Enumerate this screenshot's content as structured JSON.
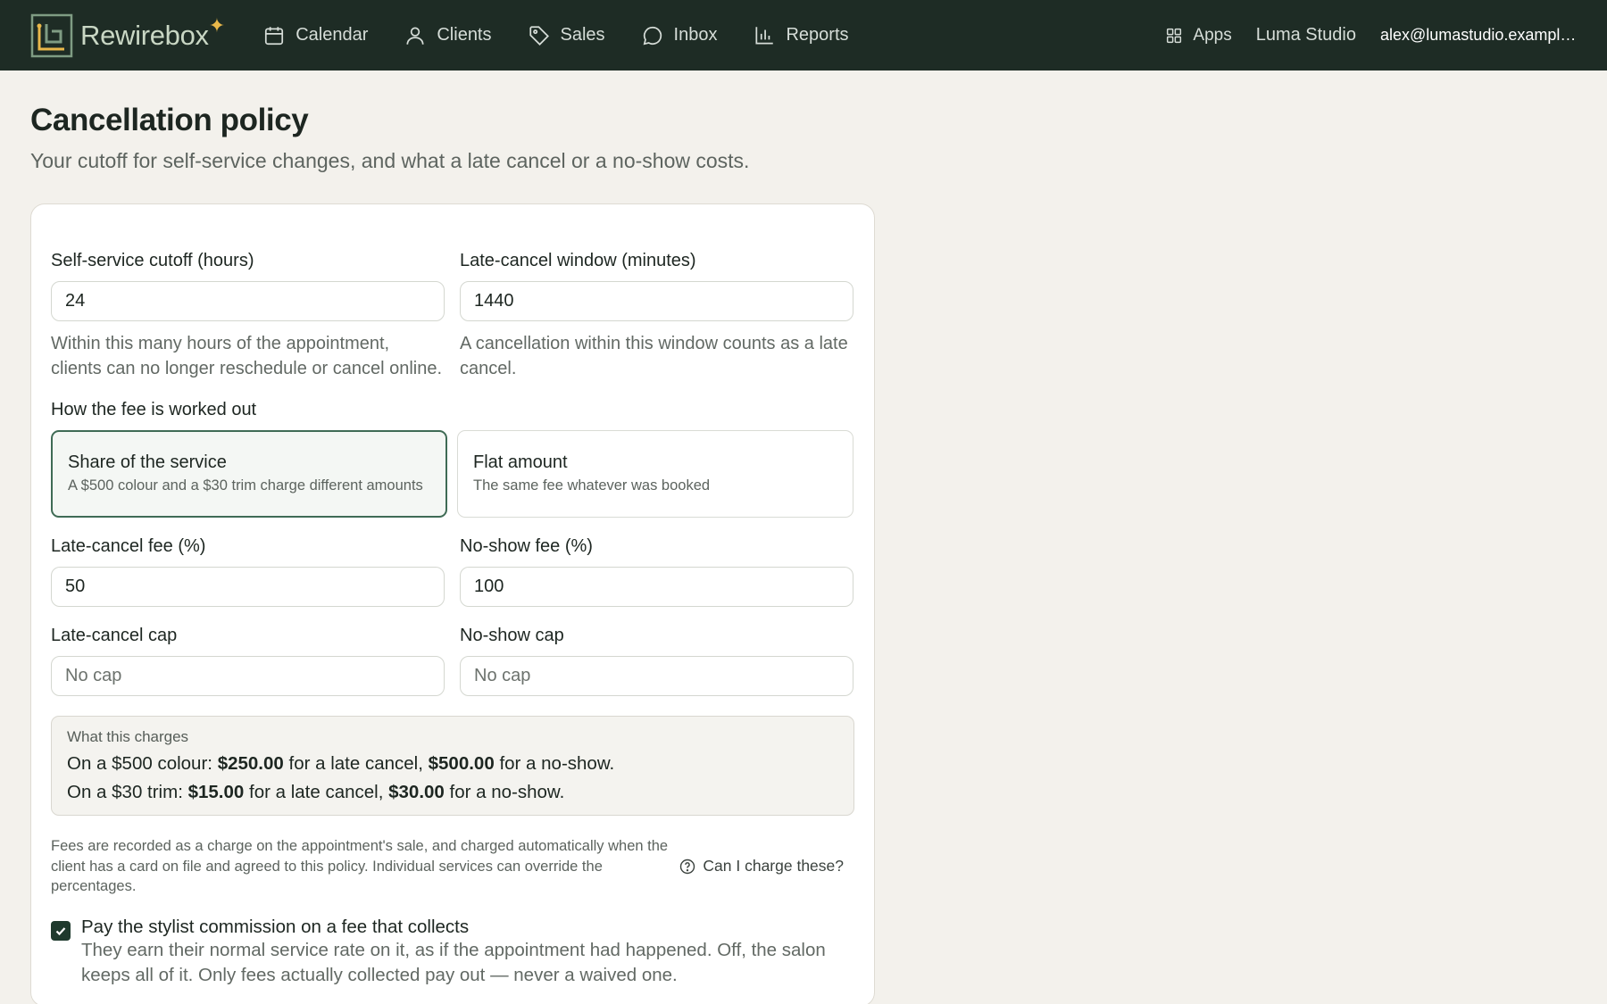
{
  "nav": {
    "brand": "Rewirebox",
    "brand_spark": "✦",
    "items": [
      {
        "label": "Calendar",
        "icon": "calendar-icon"
      },
      {
        "label": "Clients",
        "icon": "user-icon"
      },
      {
        "label": "Sales",
        "icon": "tag-icon"
      },
      {
        "label": "Inbox",
        "icon": "chat-bubble-icon"
      },
      {
        "label": "Reports",
        "icon": "bar-chart-icon"
      }
    ],
    "apps_label": "Apps",
    "studio": "Luma Studio",
    "email": "alex@lumastudio.example.com"
  },
  "page": {
    "title": "Cancellation policy",
    "subtitle": "Your cutoff for self-service changes, and what a late cancel or a no-show costs."
  },
  "form": {
    "cutoff": {
      "label": "Self-service cutoff (hours)",
      "value": "24",
      "help": "Within this many hours of the appointment, clients can no longer reschedule or cancel online."
    },
    "window": {
      "label": "Late-cancel window (minutes)",
      "value": "1440",
      "help": "A cancellation within this window counts as a late cancel."
    },
    "fee_method": {
      "label": "How the fee is worked out",
      "options": [
        {
          "title": "Share of the service",
          "desc": "A $500 colour and a $30 trim charge different amounts",
          "selected": true
        },
        {
          "title": "Flat amount",
          "desc": "The same fee whatever was booked",
          "selected": false
        }
      ]
    },
    "late_fee": {
      "label": "Late-cancel fee (%)",
      "value": "50"
    },
    "noshow_fee": {
      "label": "No-show fee (%)",
      "value": "100"
    },
    "late_cap": {
      "label": "Late-cancel cap",
      "placeholder": "No cap"
    },
    "noshow_cap": {
      "label": "No-show cap",
      "placeholder": "No cap"
    },
    "summary": {
      "heading": "What this charges",
      "lines": [
        {
          "prefix": "On a $500 colour:",
          "late": "$250.00",
          "mid": "for a late cancel,",
          "noshow": "$500.00",
          "suffix": "for a no-show."
        },
        {
          "prefix": "On a $30 trim:",
          "late": "$15.00",
          "mid": "for a late cancel,",
          "noshow": "$30.00",
          "suffix": "for a no-show."
        }
      ]
    },
    "footnote": "Fees are recorded as a charge on the appointment's sale, and charged automatically when the client has a card on file and agreed to this policy. Individual services can override the percentages.",
    "help_link": "Can I charge these?",
    "commission": {
      "checked": true,
      "title": "Pay the stylist commission on a fee that collects",
      "desc": "They earn their normal service rate on it, as if the appointment had happened. Off, the salon keeps all of it. Only fees actually collected pay out — never a waived one."
    }
  },
  "colors": {
    "topbar": "#1e2c25",
    "brand_accent": "#e9b84a",
    "selected_border": "#3f6b55",
    "checkbox": "#1f3a2d"
  }
}
